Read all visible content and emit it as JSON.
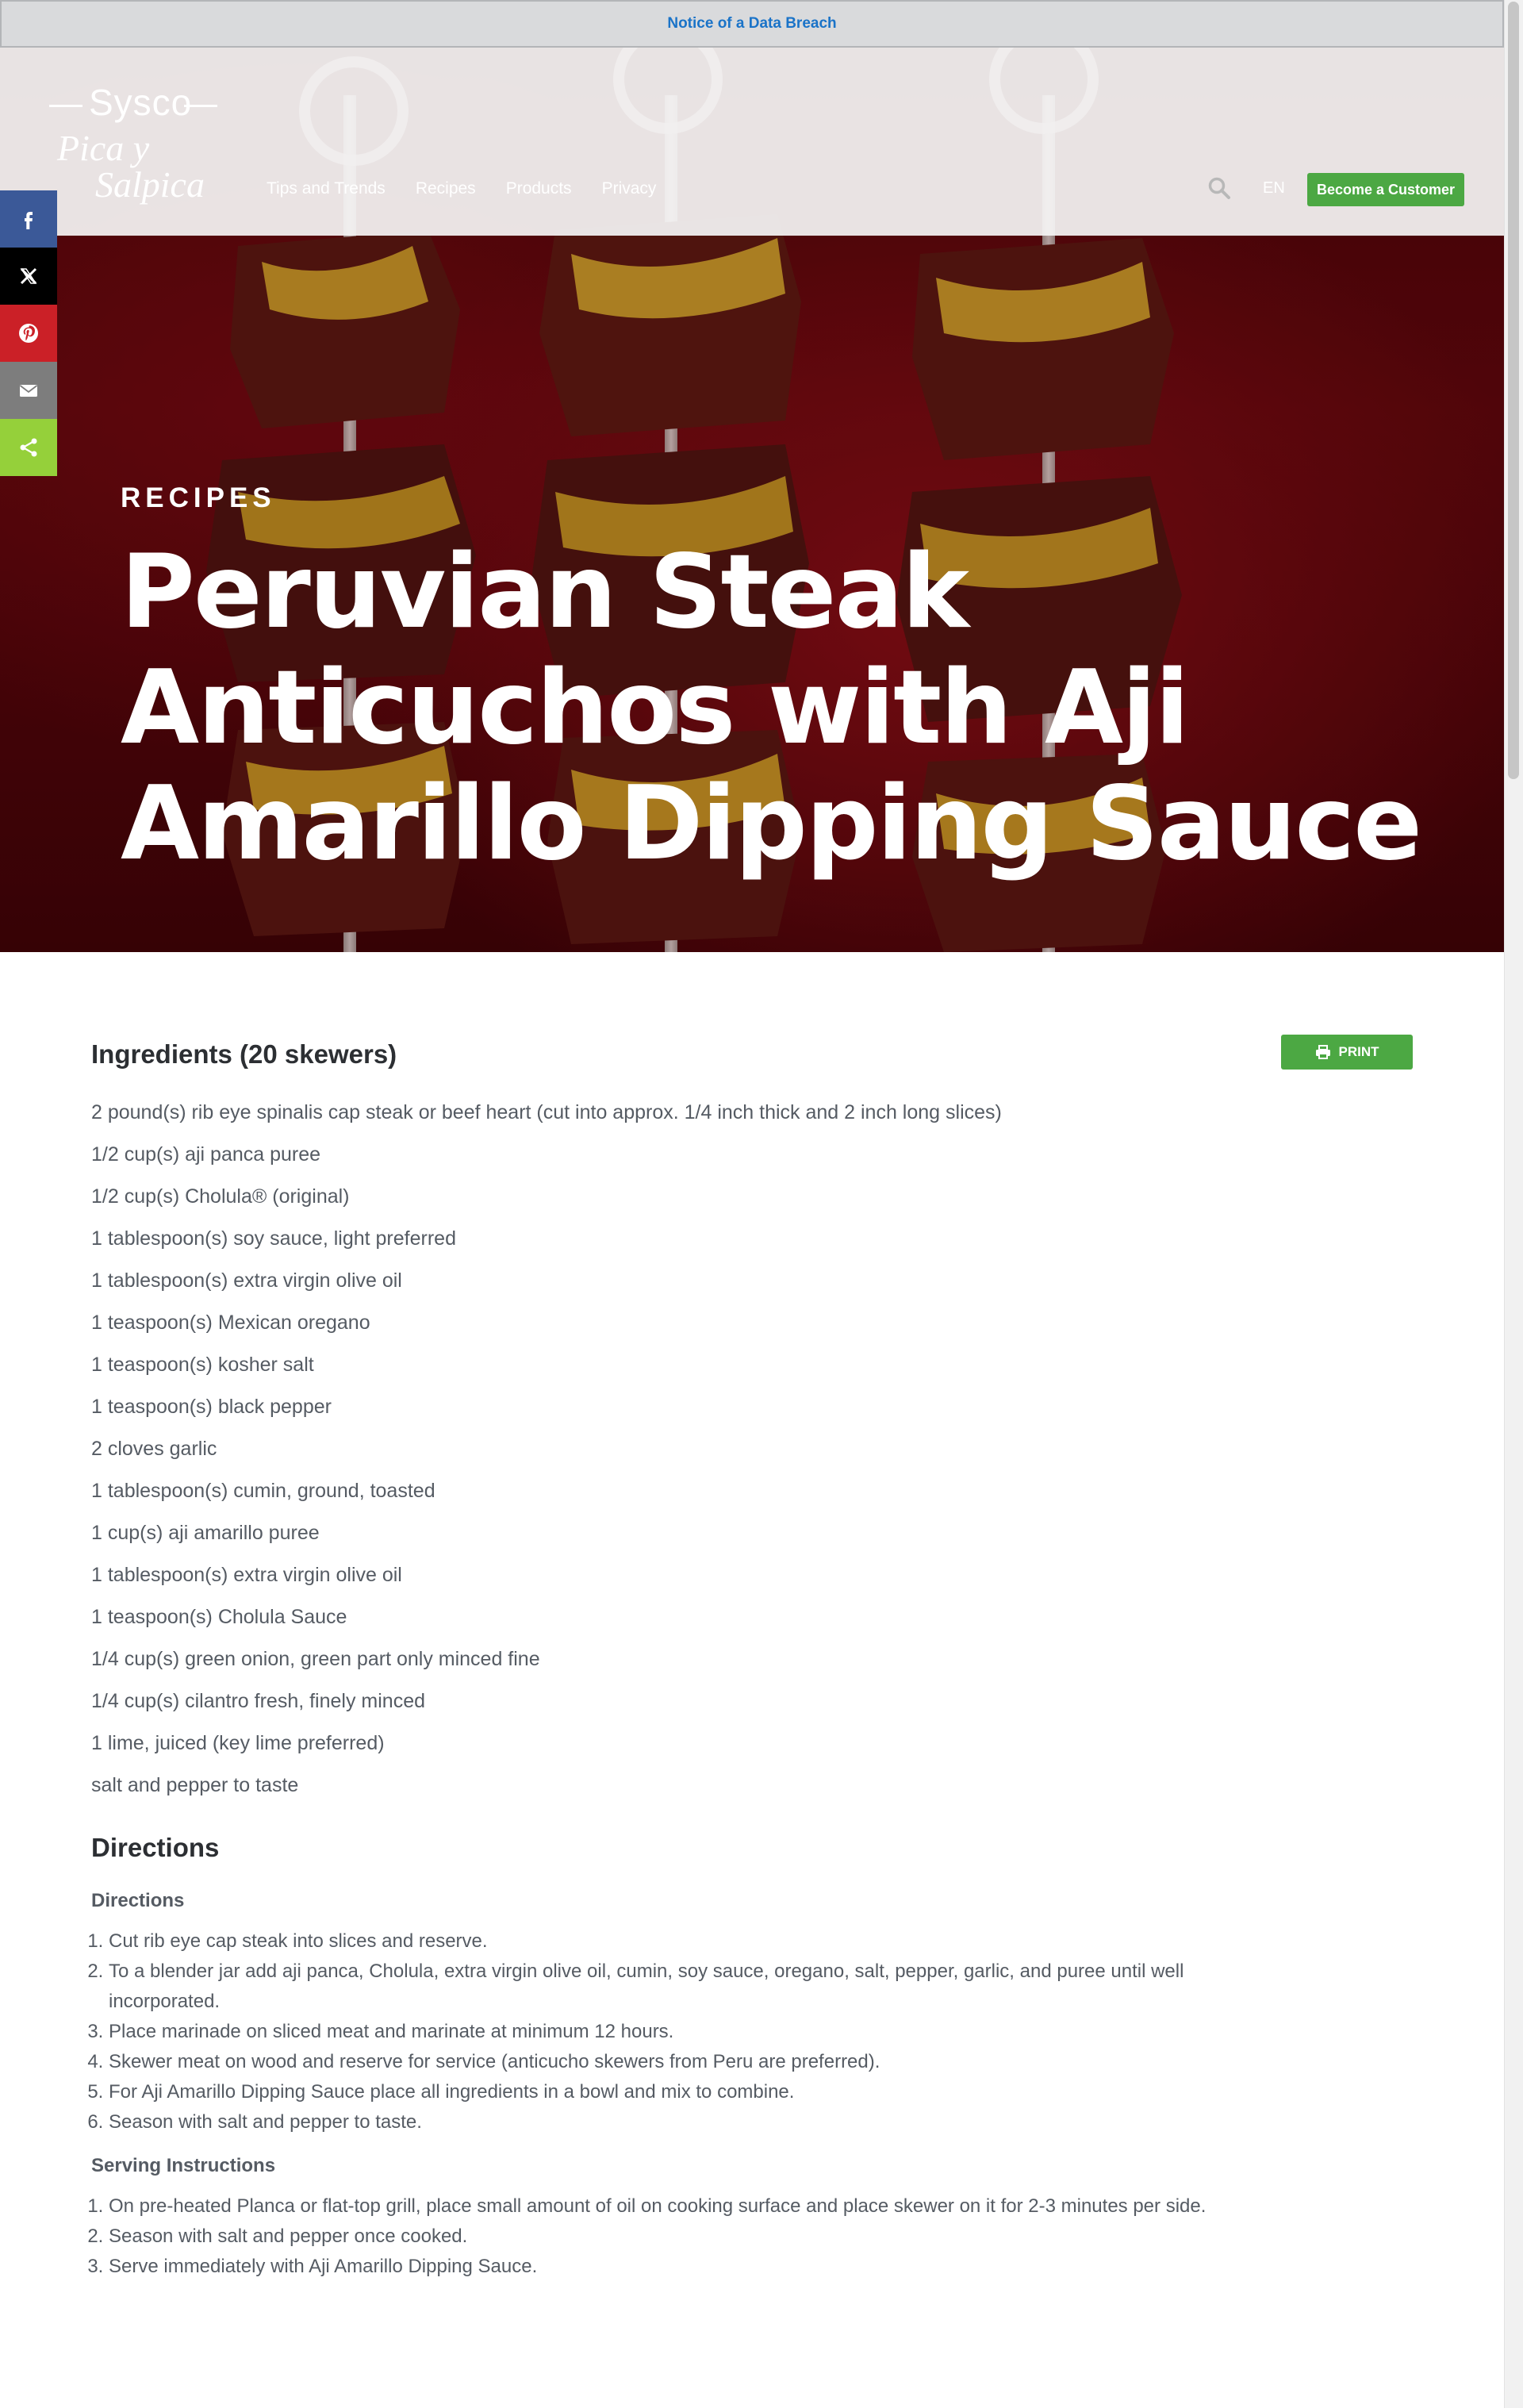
{
  "notice": {
    "label": "Notice of a Data Breach"
  },
  "brand": {
    "line1": "Sysco",
    "line2": "Pica y",
    "line3": "Salpica"
  },
  "nav": {
    "items": [
      "Tips and Trends",
      "Recipes",
      "Products",
      "Privacy"
    ]
  },
  "header": {
    "lang": "EN",
    "cta": "Become a Customer"
  },
  "hero": {
    "kicker": "RECIPES",
    "title": "Peruvian Steak Anticuchos with Aji Amarillo Dipping Sauce"
  },
  "share": {
    "items": [
      {
        "icon": "facebook-icon",
        "color": "#3b5998"
      },
      {
        "icon": "x-icon",
        "color": "#000000"
      },
      {
        "icon": "pinterest-icon",
        "color": "#cb2027"
      },
      {
        "icon": "email-icon",
        "color": "#7d7d7d"
      },
      {
        "icon": "share-icon",
        "color": "#95d03a"
      }
    ]
  },
  "ingredients": {
    "title": "Ingredients (20 skewers)",
    "print_label": "PRINT",
    "items": [
      "2 pound(s) rib eye spinalis cap steak or beef heart (cut into approx. 1/4 inch thick and 2 inch long slices)",
      "1/2 cup(s) aji panca puree",
      "1/2 cup(s) Cholula® (original)",
      "1 tablespoon(s) soy sauce, light preferred",
      "1 tablespoon(s) extra virgin olive oil",
      "1 teaspoon(s) Mexican oregano",
      "1 teaspoon(s) kosher salt",
      "1 teaspoon(s) black pepper",
      "2 cloves garlic",
      "1 tablespoon(s) cumin, ground, toasted",
      "1 cup(s) aji amarillo puree",
      "1 tablespoon(s) extra virgin olive oil",
      "1 teaspoon(s) Cholula Sauce",
      "1/4 cup(s) green onion, green part only minced fine",
      "1/4 cup(s) cilantro fresh, finely minced",
      "1 lime, juiced (key lime preferred)",
      "salt and pepper to taste"
    ]
  },
  "directions": {
    "title": "Directions",
    "sections": [
      {
        "title": "Directions",
        "steps": [
          "Cut rib eye cap steak into slices and reserve.",
          "To a blender jar add aji panca, Cholula, extra virgin olive oil, cumin, soy sauce, oregano, salt, pepper, garlic, and puree until well incorporated.",
          "Place marinade on sliced meat and marinate at minimum 12 hours.",
          "Skewer meat on wood and reserve for service (anticucho skewers from Peru are preferred).",
          "For Aji Amarillo Dipping Sauce place all ingredients in a bowl and mix to combine.",
          "Season with salt and pepper to taste."
        ]
      },
      {
        "title": "Serving Instructions",
        "steps": [
          "On pre-heated Planca or flat-top grill, place small amount of oil on cooking surface and place skewer on it for 2-3 minutes per side.",
          "Season with salt and pepper once cooked.",
          "Serve immediately with Aji Amarillo Dipping Sauce."
        ]
      }
    ]
  }
}
